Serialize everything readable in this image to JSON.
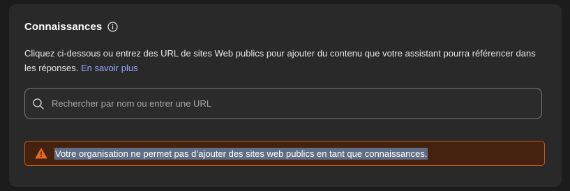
{
  "knowledge": {
    "title": "Connaissances",
    "info_icon": "info-circle-icon",
    "description": "Cliquez ci-dessous ou entrez des URL de sites Web publics pour ajouter du contenu que votre assistant pourra référencer dans les réponses.",
    "learn_more_label": "En savoir plus",
    "search": {
      "icon": "search-icon",
      "placeholder": "Rechercher par nom ou entrer une URL",
      "value": ""
    },
    "warning": {
      "icon": "warning-triangle-icon",
      "text": "Votre organisation ne permet pas d’ajouter des sites web publics en tant que connaissances.",
      "color": "#e06c1f"
    }
  }
}
